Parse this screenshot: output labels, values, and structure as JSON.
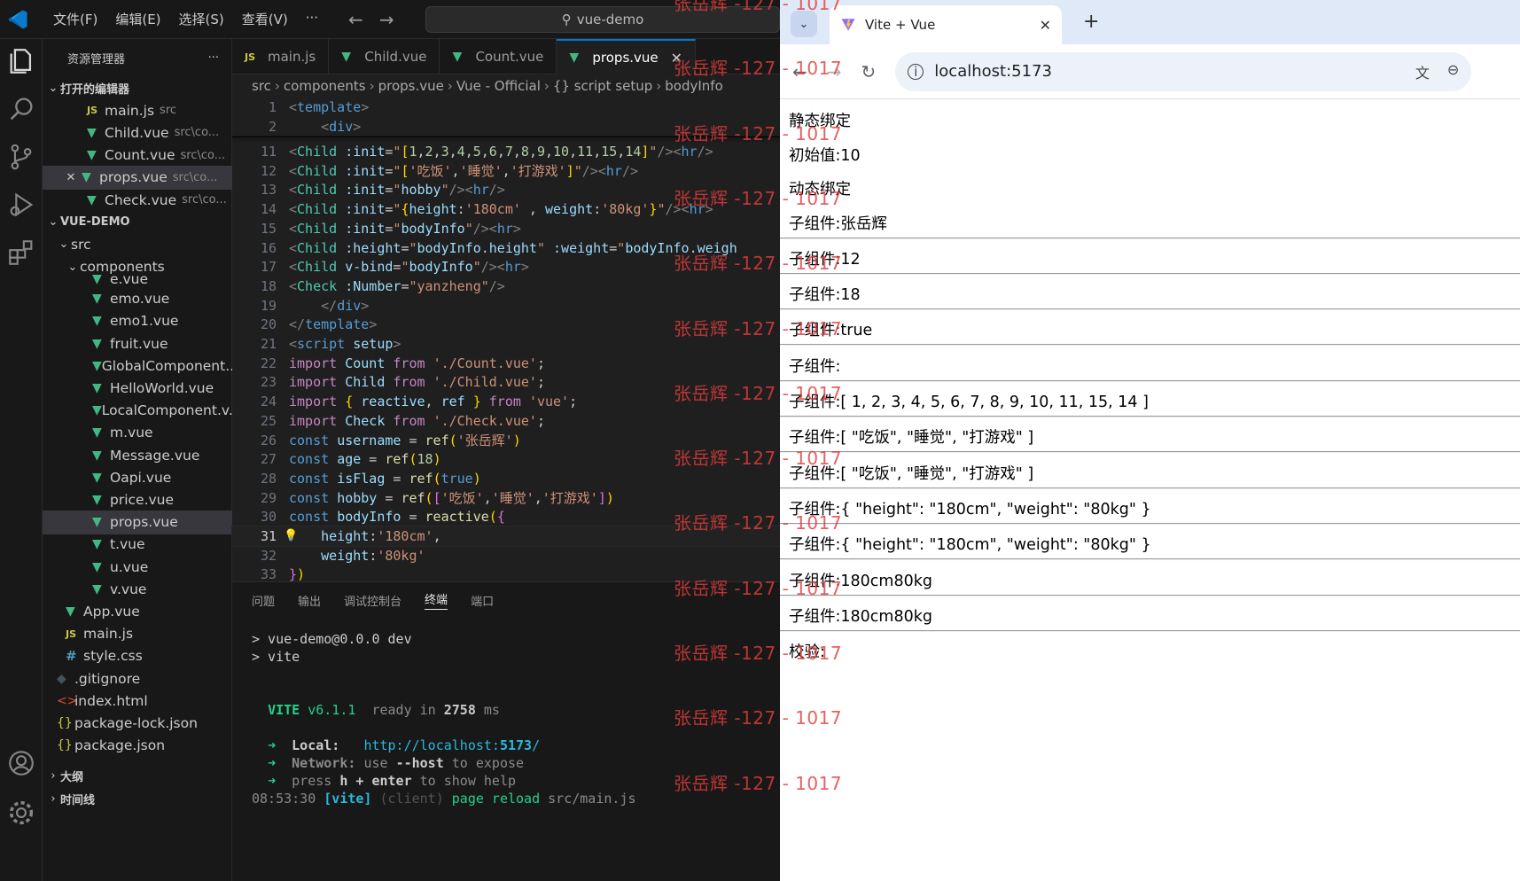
{
  "vscode": {
    "menu": [
      "文件(F)",
      "编辑(E)",
      "选择(S)",
      "查看(V)",
      "···"
    ],
    "search_text": "vue-demo",
    "sidebar": {
      "title": "资源管理器",
      "open_editors_title": "打开的编辑器",
      "open_editors": [
        {
          "name": "main.js",
          "path": "src",
          "icon": "js"
        },
        {
          "name": "Child.vue",
          "path": "src\\co...",
          "icon": "vue"
        },
        {
          "name": "Count.vue",
          "path": "src\\co...",
          "icon": "vue"
        },
        {
          "name": "props.vue",
          "path": "src\\co...",
          "icon": "vue",
          "selected": true
        },
        {
          "name": "Check.vue",
          "path": "src\\co...",
          "icon": "vue"
        }
      ],
      "project_title": "VUE-DEMO",
      "src_label": "src",
      "components_label": "components",
      "partial_label": "e.vue",
      "component_files": [
        "emo.vue",
        "emo1.vue",
        "fruit.vue",
        "GlobalComponent....",
        "HelloWorld.vue",
        "LocalComponent.v...",
        "m.vue",
        "Message.vue",
        "Oapi.vue",
        "price.vue",
        "props.vue",
        "t.vue",
        "u.vue",
        "v.vue"
      ],
      "root_files": [
        {
          "name": "App.vue",
          "icon": "vue"
        },
        {
          "name": "main.js",
          "icon": "js"
        },
        {
          "name": "style.css",
          "icon": "css"
        },
        {
          "name": ".gitignore",
          "icon": "git"
        },
        {
          "name": "index.html",
          "icon": "html"
        },
        {
          "name": "package-lock.json",
          "icon": "json"
        },
        {
          "name": "package.json",
          "icon": "json"
        }
      ],
      "outline_label": "大纲",
      "timeline_label": "时间线"
    },
    "tabs": [
      {
        "label": "main.js",
        "icon": "JS"
      },
      {
        "label": "Child.vue",
        "icon": "V"
      },
      {
        "label": "Count.vue",
        "icon": "V"
      },
      {
        "label": "props.vue",
        "icon": "V",
        "active": true
      }
    ],
    "breadcrumb": [
      "src",
      "components",
      "props.vue",
      "Vue - Official",
      "{} script setup",
      "bodyInfo"
    ],
    "code_lines": [
      {
        "n": "1",
        "html": "<span class='p'>&lt;</span><span class='k'>template</span><span class='p'>&gt;</span>"
      },
      {
        "n": "2",
        "html": "    <span class='p'>&lt;</span><span class='k'>div</span><span class='p'>&gt;</span>"
      },
      {
        "n": "11",
        "html": "<span class='p'>&lt;</span><span class='t'>Child</span> <span class='a'>:init</span>=<span class='s'>\"</span><span class='y'>[</span><span class='n'>1</span>,<span class='n'>2</span>,<span class='n'>3</span>,<span class='n'>4</span>,<span class='n'>5</span>,<span class='n'>6</span>,<span class='n'>7</span>,<span class='n'>8</span>,<span class='n'>9</span>,<span class='n'>10</span>,<span class='n'>11</span>,<span class='n'>15</span>,<span class='n'>14</span><span class='y'>]</span><span class='s'>\"</span><span class='p'>/&gt;&lt;</span><span class='k'>hr</span><span class='p'>/&gt;</span>"
      },
      {
        "n": "12",
        "html": "<span class='p'>&lt;</span><span class='t'>Child</span> <span class='a'>:init</span>=<span class='s'>\"</span><span class='y'>[</span><span class='s'>'吃饭'</span>,<span class='s'>'睡觉'</span>,<span class='s'>'打游戏'</span><span class='y'>]</span><span class='s'>\"</span><span class='p'>/&gt;&lt;</span><span class='k'>hr</span><span class='p'>/&gt;</span>"
      },
      {
        "n": "13",
        "html": "<span class='p'>&lt;</span><span class='t'>Child</span> <span class='a'>:init</span>=<span class='s'>\"</span><span class='a'>hobby</span><span class='s'>\"</span><span class='p'>/&gt;&lt;</span><span class='k'>hr</span><span class='p'>/&gt;</span>"
      },
      {
        "n": "14",
        "html": "<span class='p'>&lt;</span><span class='t'>Child</span> <span class='a'>:init</span>=<span class='s'>\"</span><span class='y'>{</span><span class='a'>height</span>:<span class='s'>'180cm'</span> , <span class='a'>weight</span>:<span class='s'>'80kg'</span><span class='y'>}</span><span class='s'>\"</span><span class='p'>/&gt;&lt;</span><span class='k'>hr</span><span class='p'>&gt;</span>"
      },
      {
        "n": "15",
        "html": "<span class='p'>&lt;</span><span class='t'>Child</span> <span class='a'>:init</span>=<span class='s'>\"</span><span class='a'>bodyInfo</span><span class='s'>\"</span><span class='p'>/&gt;&lt;</span><span class='k'>hr</span><span class='p'>&gt;</span>"
      },
      {
        "n": "16",
        "html": "<span class='p'>&lt;</span><span class='t'>Child</span> <span class='a'>:height</span>=<span class='s'>\"</span><span class='a'>bodyInfo</span>.<span class='a'>height</span><span class='s'>\"</span> <span class='a'>:weight</span>=<span class='s'>\"</span><span class='a'>bodyInfo</span>.<span class='a'>weigh</span>"
      },
      {
        "n": "17",
        "html": "<span class='p'>&lt;</span><span class='t'>Child</span> <span class='a'>v-bind</span>=<span class='s'>\"</span><span class='a'>bodyInfo</span><span class='s'>\"</span><span class='p'>/&gt;&lt;</span><span class='k'>hr</span><span class='p'>&gt;</span>"
      },
      {
        "n": "18",
        "html": "<span class='p'>&lt;</span><span class='t'>Check</span> <span class='a'>:Number</span>=<span class='s'>\"</span><span class='s'>yanzheng</span><span class='s'>\"</span><span class='p'>/&gt;</span>"
      },
      {
        "n": "19",
        "html": "    <span class='p'>&lt;/</span><span class='k'>div</span><span class='p'>&gt;</span>"
      },
      {
        "n": "20",
        "html": "<span class='p'>&lt;/</span><span class='k'>template</span><span class='p'>&gt;</span>"
      },
      {
        "n": "21",
        "html": "<span class='p'>&lt;</span><span class='k'>script</span> <span class='a'>setup</span><span class='p'>&gt;</span>"
      },
      {
        "n": "22",
        "html": "<span class='kw'>import</span> <span class='a'>Count</span> <span class='kw'>from</span> <span class='s'>'./Count.vue'</span>;"
      },
      {
        "n": "23",
        "html": "<span class='kw'>import</span> <span class='a'>Child</span> <span class='kw'>from</span> <span class='s'>'./Child.vue'</span>;"
      },
      {
        "n": "24",
        "html": "<span class='kw'>import</span> <span class='y'>{</span> <span class='a'>reactive</span>, <span class='a'>ref</span> <span class='y'>}</span> <span class='kw'>from</span> <span class='s'>'vue'</span>;"
      },
      {
        "n": "25",
        "html": "<span class='kw'>import</span> <span class='a'>Check</span> <span class='kw'>from</span> <span class='s'>'./Check.vue'</span>;"
      },
      {
        "n": "26",
        "html": "<span class='k'>const</span> <span class='a'>username</span> = <span class='f'>ref</span><span class='y'>(</span><span class='s'>'张岳辉'</span><span class='y'>)</span>"
      },
      {
        "n": "27",
        "html": "<span class='k'>const</span> <span class='a'>age</span> = <span class='f'>ref</span><span class='y'>(</span><span class='n'>18</span><span class='y'>)</span>"
      },
      {
        "n": "28",
        "html": "<span class='k'>const</span> <span class='a'>isFlag</span> = <span class='f'>ref</span><span class='y'>(</span><span class='k'>true</span><span class='y'>)</span>"
      },
      {
        "n": "29",
        "html": "<span class='k'>const</span> <span class='a'>hobby</span> = <span class='f'>ref</span><span class='y'>(</span><span class='br'>[</span><span class='s'>'吃饭'</span>,<span class='s'>'睡觉'</span>,<span class='s'>'打游戏'</span><span class='br'>]</span><span class='y'>)</span>"
      },
      {
        "n": "30",
        "html": "<span class='k'>const</span> <span class='a'>bodyInfo</span> = <span class='f'>reactive</span><span class='y'>(</span><span class='br'>{</span>"
      },
      {
        "n": "31",
        "html": "    <span class='a'>height</span>:<span class='s'>'180cm'</span>,"
      },
      {
        "n": "32",
        "html": "    <span class='a'>weight</span>:<span class='s'>'80kg'</span>"
      },
      {
        "n": "33",
        "html": "<span class='br'>}</span><span class='y'>)</span>"
      }
    ],
    "panel_tabs": [
      "问题",
      "输出",
      "调试控制台",
      "终端",
      "端口"
    ],
    "terminal": {
      "line1": "> vue-demo@0.0.0 dev",
      "line2": "> vite",
      "vite_name": "VITE",
      "vite_version": "v6.1.1",
      "ready_label": "ready in",
      "ready_ms": "2758",
      "ready_unit": "ms",
      "local_label": "Local:",
      "local_url_prefix": "http://localhost:",
      "local_port": "5173",
      "network_label": "Network:",
      "network_text_a": "use",
      "network_flag": "--host",
      "network_text_b": "to expose",
      "help_a": "press",
      "help_key": "h + enter",
      "help_b": "to show help",
      "log_time": "08:53:30",
      "log_tag": "[vite]",
      "log_client": "(client)",
      "log_msg": "page reload",
      "log_file": "src/main.js"
    }
  },
  "browser": {
    "tab_title": "Vite + Vue",
    "url": "localhost:5173",
    "page_lines": [
      {
        "text": "静态绑定",
        "hr": false
      },
      {
        "text": "初始值:10",
        "hr": false
      },
      {
        "text": "动态绑定",
        "hr": false
      },
      {
        "text": "子组件:张岳辉",
        "hr": true
      },
      {
        "text": "子组件:12",
        "hr": true
      },
      {
        "text": "子组件:18",
        "hr": true
      },
      {
        "text": "子组件:true",
        "hr": true
      },
      {
        "text": "子组件:",
        "hr": true
      },
      {
        "text": "子组件:[ 1, 2, 3, 4, 5, 6, 7, 8, 9, 10, 11, 15, 14 ]",
        "hr": true
      },
      {
        "text": "子组件:[ \"吃饭\", \"睡觉\", \"打游戏\" ]",
        "hr": true
      },
      {
        "text": "子组件:[ \"吃饭\", \"睡觉\", \"打游戏\" ]",
        "hr": true
      },
      {
        "text": "子组件:{ \"height\": \"180cm\", \"weight\": \"80kg\" }",
        "hr": true
      },
      {
        "text": "子组件:{ \"height\": \"180cm\", \"weight\": \"80kg\" }",
        "hr": true
      },
      {
        "text": "子组件:180cm80kg",
        "hr": true
      },
      {
        "text": "子组件:180cm80kg",
        "hr": true
      },
      {
        "text": "校验:",
        "hr": false
      }
    ]
  },
  "watermark": "张岳辉 -127 - 1017",
  "colors": {
    "vscode_bg": "#1f1f1f",
    "accent": "#0078d4",
    "vue_green": "#41b883",
    "watermark": "#e23c3c"
  }
}
